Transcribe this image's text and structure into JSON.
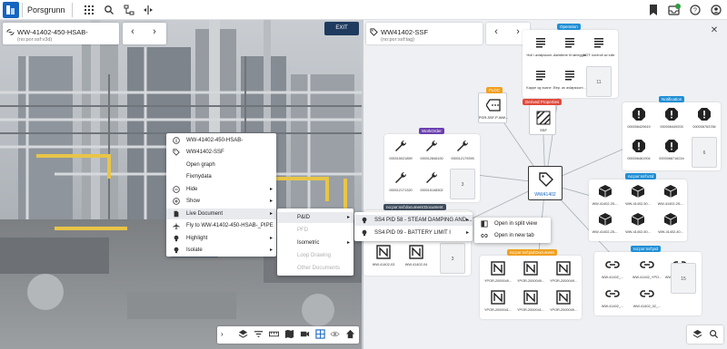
{
  "app": {
    "brand": "Porsgrunn"
  },
  "colors": {
    "brand": "#1565c0",
    "exit": "#1e3a5f",
    "tag_purple": "#6b3fb0",
    "tag_blue": "#1f8fd6",
    "tag_orange": "#f0a020",
    "tag_red": "#e04a3c",
    "tag_dark": "#3d4b5c"
  },
  "left_card": {
    "title": "WW-41402-450-HSAB-",
    "subtitle": "(no:por:ssf:v3d)"
  },
  "right_card": {
    "title": "WW41402-SSF",
    "subtitle": "(no:por:ssf:tag)"
  },
  "exit_label": "EXIT",
  "context_menu": {
    "items": [
      {
        "label": "WW-41402-450-HSAB-",
        "icon": "info-icon"
      },
      {
        "label": "WW41402-SSF",
        "icon": "tag-icon"
      },
      {
        "label": "Open graph",
        "icon": ""
      },
      {
        "label": "Fixmydata",
        "icon": ""
      },
      {
        "label": "Hide",
        "icon": "minus-circle-icon"
      },
      {
        "label": "Show",
        "icon": "plus-circle-icon"
      },
      {
        "label": "Live Document",
        "icon": "document-icon"
      },
      {
        "label": "Fly to WW-41402-450-HSAB-_PIPE",
        "icon": "plane-icon"
      },
      {
        "label": "Highlight",
        "icon": "lightbulb-icon"
      },
      {
        "label": "Isolate",
        "icon": "lightbulb-icon"
      }
    ]
  },
  "submenu_doc": {
    "items": [
      {
        "label": "P&ID",
        "enabled": true
      },
      {
        "label": "PFD",
        "enabled": false
      },
      {
        "label": "Isometric",
        "enabled": true
      },
      {
        "label": "Loop Drawing",
        "enabled": false
      },
      {
        "label": "Other Documents",
        "enabled": false
      }
    ]
  },
  "submenu_pid": {
    "items": [
      {
        "label": "SS4 PID 58 - STEAM DAMPING AND ..."
      },
      {
        "label": "SS4 PID 09 - BATTERY LIMIT I"
      }
    ]
  },
  "submenu_open": {
    "items": [
      {
        "label": "Open in split view"
      },
      {
        "label": "Open in new tab"
      }
    ]
  },
  "graph": {
    "center_label": "WW41402",
    "flod": {
      "tag": "FLOC",
      "caption": "PGR-SSF-P-WW..."
    },
    "derived": {
      "tag": "Derived Properties",
      "caption": "SSF"
    },
    "operation": {
      "tag": "Operation",
      "captions": [
        "Hull i avløpssom...",
        "Asfaltene til rørlegger...",
        "NOT: kontroll av lulle",
        "Kappe og svane ...",
        "Rep. av avløpssom ...",
        "11"
      ]
    },
    "workorder": {
      "tag": "WorkOrder",
      "captions": [
        "000015021859",
        "000012846100",
        "000012179393",
        "000012171320",
        "000015148302",
        "3"
      ]
    },
    "notification": {
      "tag": "Notification",
      "captions": [
        "000006429619",
        "000006449203",
        "000006763784",
        "000006461904",
        "000006871621b",
        "6"
      ]
    },
    "v3d": {
      "tag": "no:por:ssf:v3d",
      "captions": [
        "WW-41402-25-...",
        "WW-41402-50...",
        "WW-41402-25-...",
        "WW-41402-25-...",
        "WW-41402-50...",
        "WW-41402-40..."
      ]
    },
    "document": {
      "tag": "no:por:ssf:document:Document",
      "captions": [
        "WW-41402-03",
        "WW-41402-04",
        "3"
      ]
    },
    "ssfpid": {
      "tag": "no:por:ssf:pid:Document",
      "captions": [
        "YPOR-2000049...",
        "YPOR-2000049...",
        "YPOR-2000049...",
        "YPOR-2000041...",
        "YPOR-2000041...",
        "YPOR-2000049..."
      ]
    },
    "sfpid": {
      "tag": "no:por:ssf:pid",
      "captions": [
        "WW-41402_...",
        "WW-41402_YPO...",
        "WW-41402_YPO...",
        "WW-41402_...",
        "WW-41402_02_...",
        "15"
      ]
    }
  }
}
